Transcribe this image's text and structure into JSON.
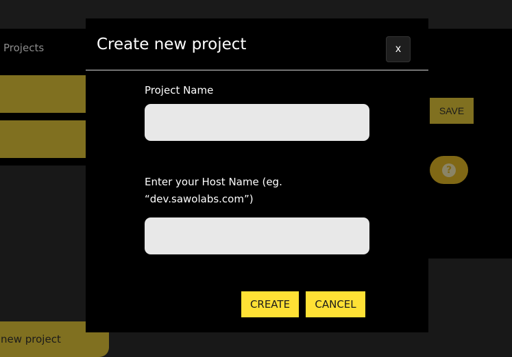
{
  "background": {
    "projects_label": "Projects",
    "save_label": "SAVE",
    "help_glyph": "?",
    "new_project_label": "new project"
  },
  "modal": {
    "title": "Create new project",
    "close_label": "x",
    "project_name": {
      "label": "Project Name",
      "value": "",
      "placeholder": ""
    },
    "host_name": {
      "label": "Enter your Host Name (eg. “dev.sawolabs.com”)",
      "value": "",
      "placeholder": ""
    },
    "create_label": "CREATE",
    "cancel_label": "CANCEL"
  },
  "colors": {
    "accent": "#ffe135",
    "dimmed_accent": "#807020",
    "modal_bg": "#000000",
    "input_bg": "#e8e8e8"
  },
  "icons": {
    "help": "question-circle-icon"
  }
}
